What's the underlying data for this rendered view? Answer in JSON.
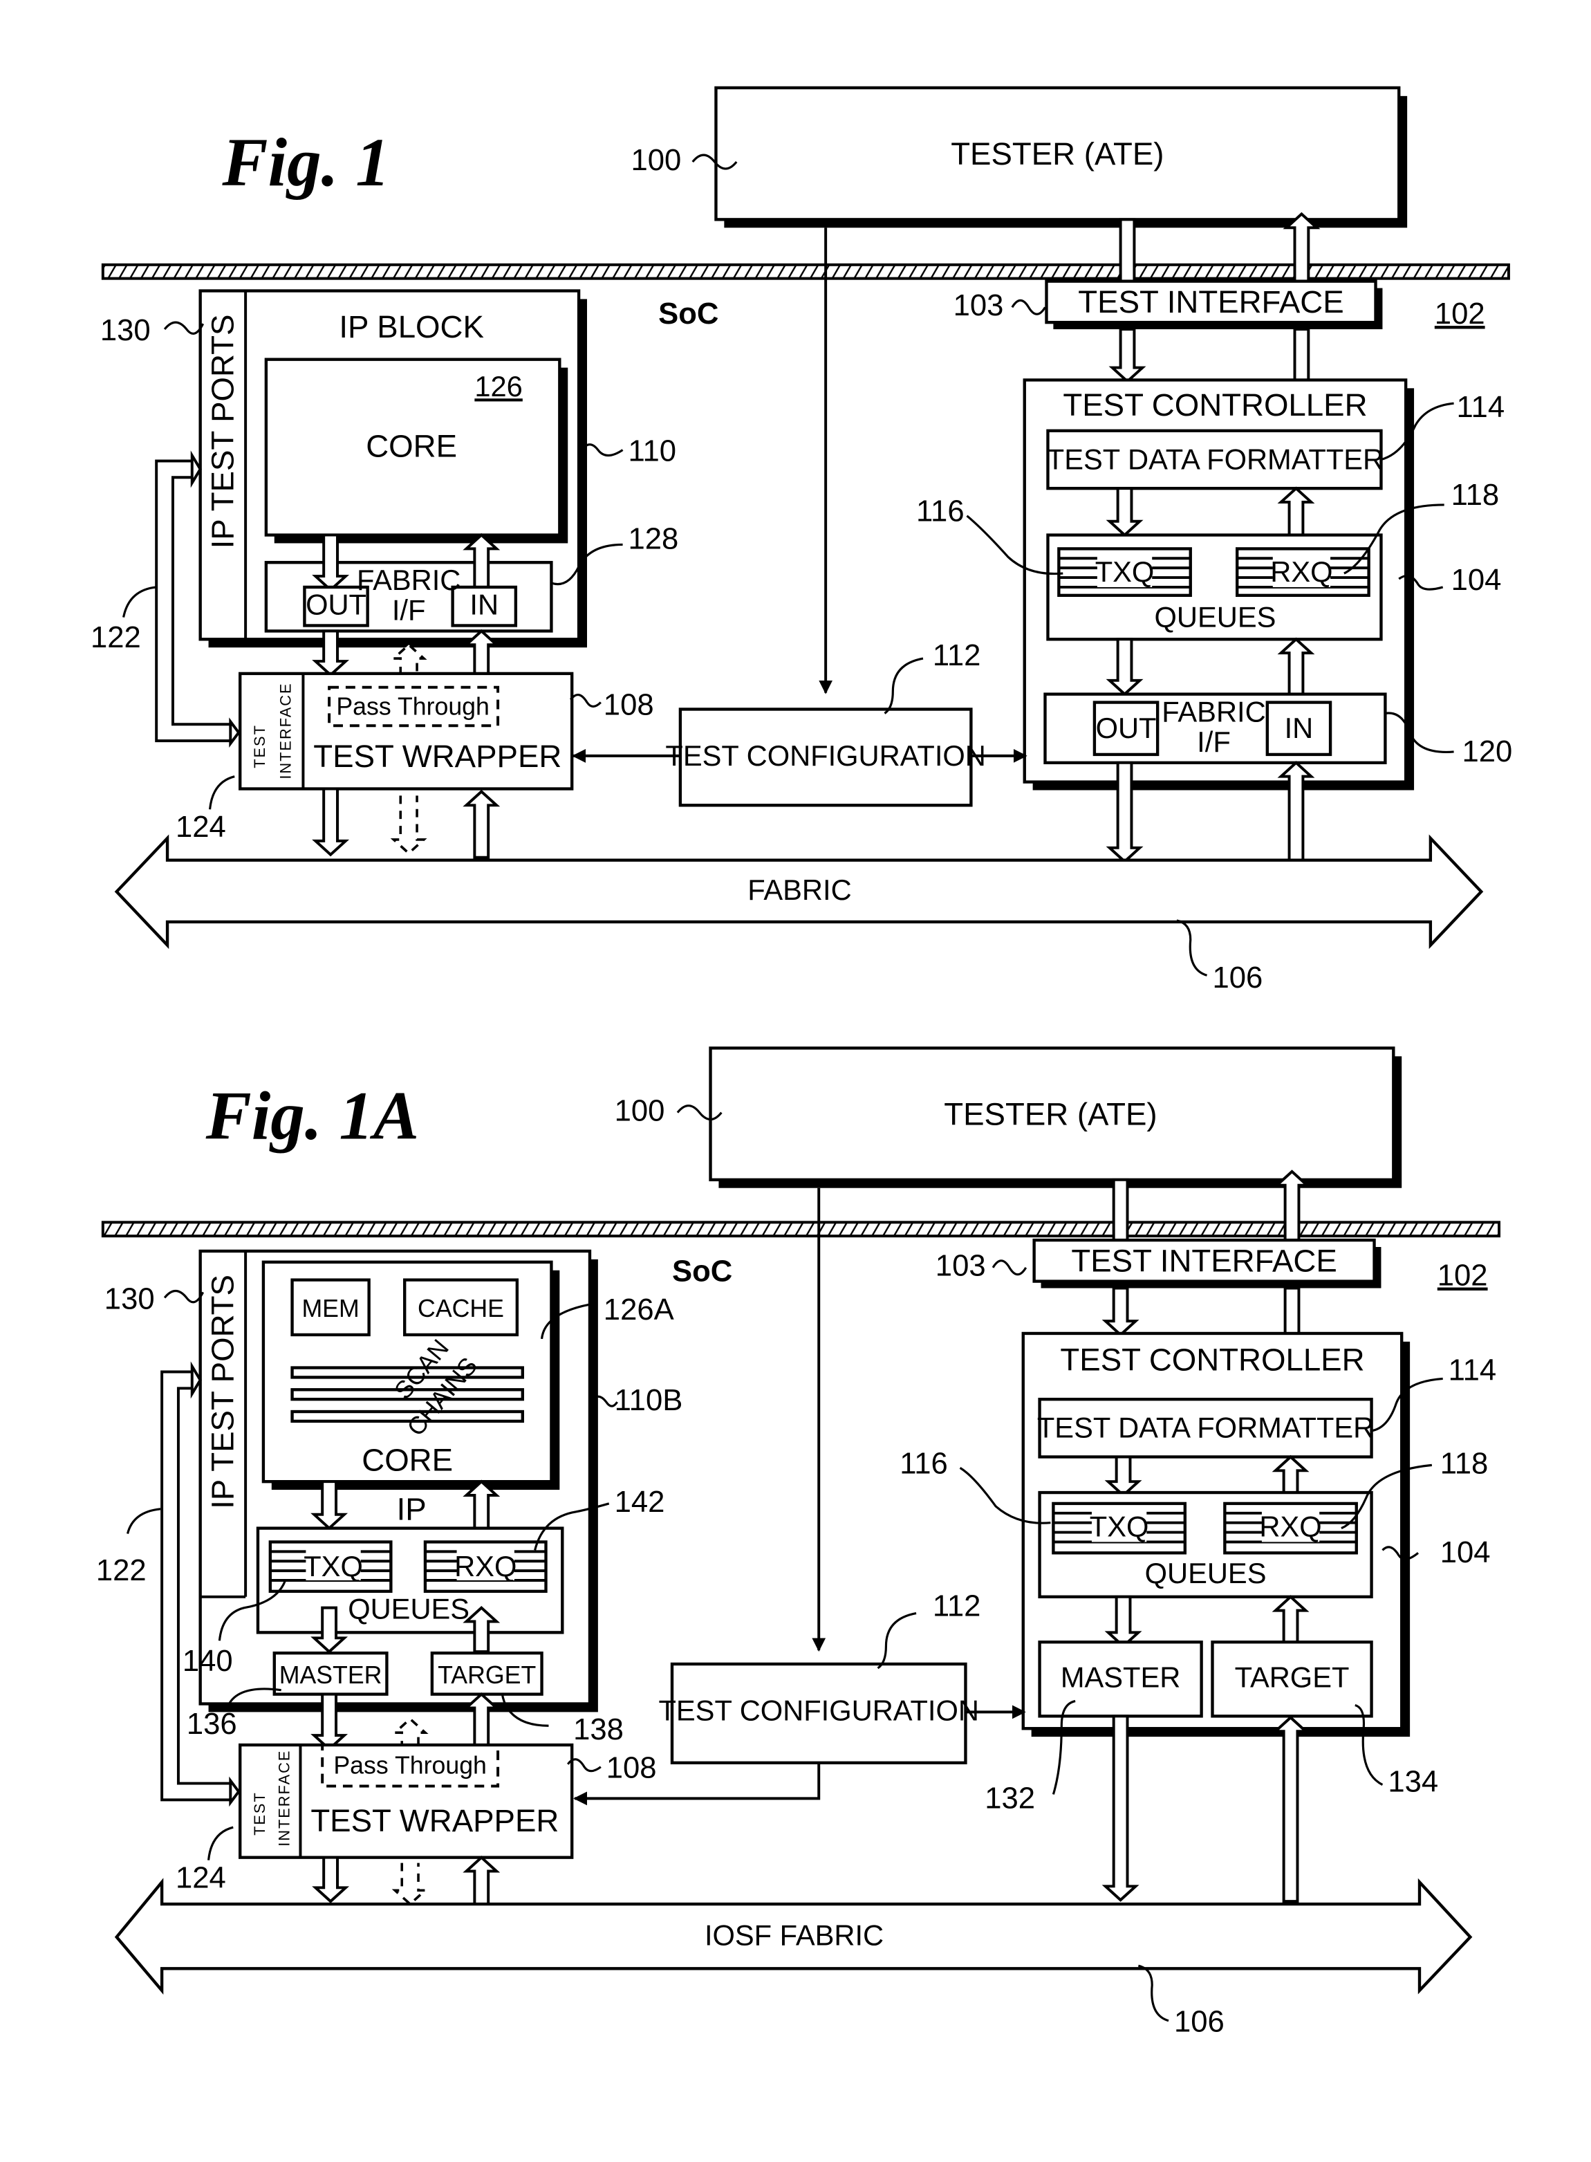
{
  "figures": [
    {
      "title": "Fig. 1",
      "tester": {
        "label": "TESTER (ATE)",
        "ref": "100"
      },
      "soc_label": "SoC",
      "soc_ref": "102",
      "test_interface": {
        "label": "TEST INTERFACE",
        "ref": "103"
      },
      "ip_test_ports": {
        "label": "IP TEST PORTS",
        "ref": "130"
      },
      "ip_block": {
        "label": "IP BLOCK",
        "ref": "110"
      },
      "core": {
        "label": "CORE",
        "ref": "126"
      },
      "fabric_if": {
        "label_line1": "FABRIC",
        "label_line2": "I/F",
        "ref": "128",
        "out": "OUT",
        "in": "IN"
      },
      "link_ref": "122",
      "wrapper": {
        "label": "TEST WRAPPER",
        "pass_through": "Pass Through",
        "interface_line1": "TEST",
        "interface_line2": "INTERFACE",
        "ref": "108",
        "interface_ref": "124"
      },
      "test_config": {
        "label": "TEST CONFIGURATION",
        "ref": "112"
      },
      "controller": {
        "label": "TEST CONTROLLER",
        "ref": "104",
        "formatter": {
          "label": "TEST DATA FORMATTER",
          "ref": "114"
        },
        "queues": {
          "label": "QUEUES",
          "txq": "TXQ",
          "rxq": "RXQ",
          "txq_ref": "116",
          "rxq_ref": "118"
        },
        "fabric_if": {
          "label_line1": "FABRIC",
          "label_line2": "I/F",
          "out": "OUT",
          "in": "IN",
          "ref": "120"
        }
      },
      "fabric": {
        "label": "FABRIC",
        "ref": "106"
      }
    },
    {
      "title": "Fig. 1A",
      "tester": {
        "label": "TESTER (ATE)",
        "ref": "100"
      },
      "soc_label": "SoC",
      "soc_ref": "102",
      "test_interface": {
        "label": "TEST INTERFACE",
        "ref": "103"
      },
      "ip_test_ports": {
        "label": "IP TEST PORTS",
        "ref": "130"
      },
      "ip_block": {
        "label": "IP",
        "ref": "110B"
      },
      "core": {
        "label": "CORE",
        "ref": "126A",
        "mem": "MEM",
        "cache": "CACHE",
        "scan_line1": "SCAN",
        "scan_line2": "CHAINS"
      },
      "ip_queues": {
        "label": "QUEUES",
        "txq": "TXQ",
        "rxq": "RXQ",
        "txq_ref": "140",
        "rxq_ref": "142"
      },
      "ip_master": {
        "label": "MASTER",
        "ref": "136"
      },
      "ip_target": {
        "label": "TARGET",
        "ref": "138"
      },
      "link_ref": "122",
      "wrapper": {
        "label": "TEST WRAPPER",
        "pass_through": "Pass Through",
        "interface_line1": "TEST",
        "interface_line2": "INTERFACE",
        "ref": "108",
        "interface_ref": "124"
      },
      "test_config": {
        "label": "TEST CONFIGURATION",
        "ref": "112"
      },
      "controller": {
        "label": "TEST CONTROLLER",
        "ref": "104",
        "formatter": {
          "label": "TEST DATA FORMATTER",
          "ref": "114"
        },
        "queues": {
          "label": "QUEUES",
          "txq": "TXQ",
          "rxq": "RXQ",
          "txq_ref": "116",
          "rxq_ref": "118"
        },
        "master": {
          "label": "MASTER",
          "ref": "132"
        },
        "target": {
          "label": "TARGET",
          "ref": "134"
        }
      },
      "fabric": {
        "label": "IOSF FABRIC",
        "ref": "106"
      }
    }
  ]
}
